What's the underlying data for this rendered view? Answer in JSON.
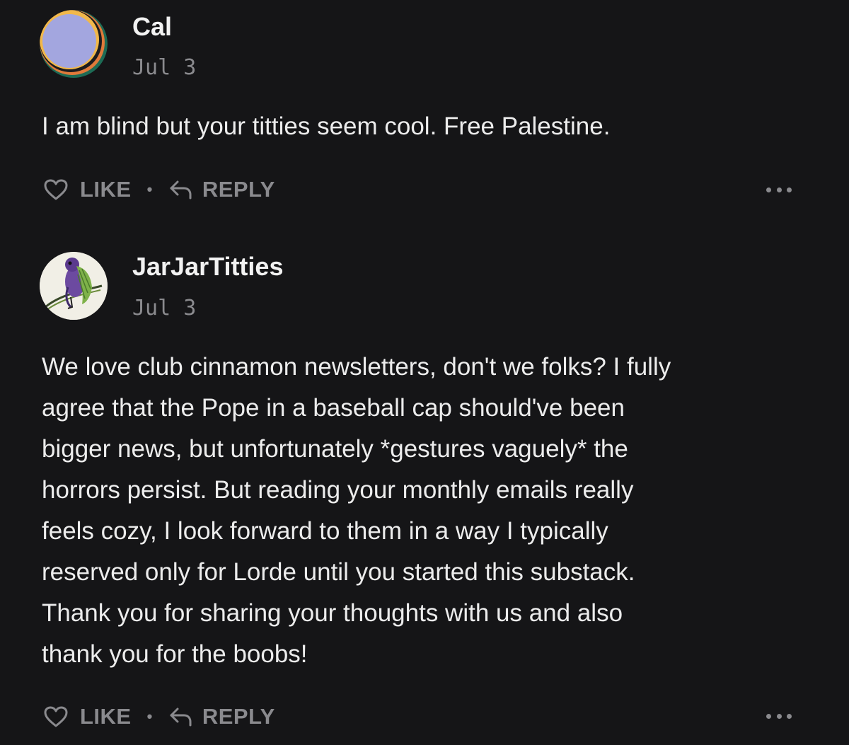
{
  "comments": [
    {
      "author": "Cal",
      "date": "Jul 3",
      "avatar_icon": "abstract-circle-avatar",
      "body": "I am blind but your titties seem cool. Free Palestine.",
      "like_label": "LIKE",
      "reply_label": "REPLY"
    },
    {
      "author": "JarJarTitties",
      "date": "Jul 3",
      "avatar_icon": "purple-bird-illustration-avatar",
      "body": "We love club cinnamon newsletters, don't we folks? I fully\nagree that the Pope in a baseball cap should've been\nbigger news, but unfortunately *gestures vaguely* the\nhorrors persist. But reading your monthly emails really\nfeels cozy, I look forward to them in a way I typically\nreserved only for Lorde until you started this substack.\nThank you for sharing your thoughts with us and also\nthank you for the boobs!",
      "like_label": "LIKE",
      "reply_label": "REPLY"
    }
  ],
  "colors": {
    "background": "#151517",
    "text": "#ececec",
    "muted": "#8a8a8e"
  }
}
